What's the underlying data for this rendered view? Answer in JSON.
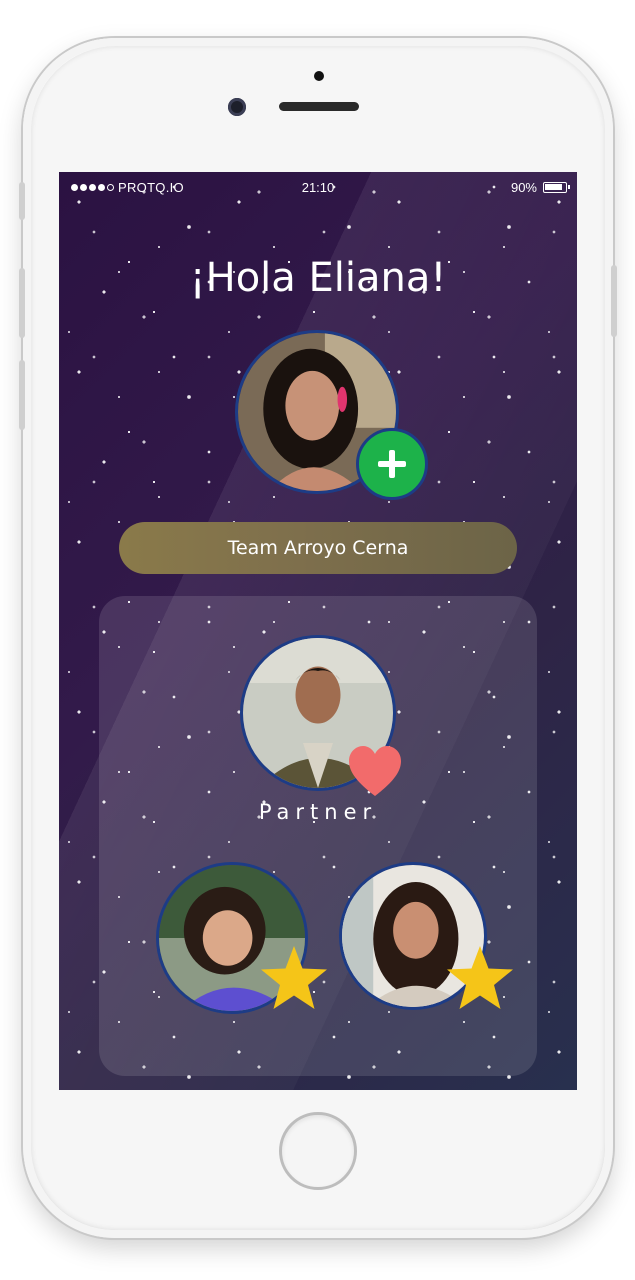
{
  "status_bar": {
    "carrier": "PROTQ.IO",
    "time": "21:10",
    "battery": "90%",
    "signal_bars": 4
  },
  "greeting": "¡Hola Eliana!",
  "team": {
    "name": "Team Arroyo Cerna"
  },
  "family": {
    "partner_label": "Partner"
  },
  "icons": {
    "add": "plus-icon",
    "partner_badge": "heart-icon",
    "child_badge": "star-icon"
  },
  "colors": {
    "add_badge": "#1db24a",
    "heart": "#f26b6b",
    "star": "#f5c518",
    "avatar_ring": "#1d3c86",
    "team_pill": "#7e6f4c"
  }
}
